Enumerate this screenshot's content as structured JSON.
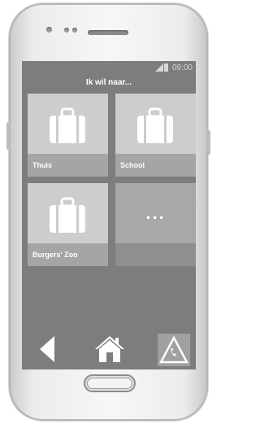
{
  "status_bar": {
    "time": "09:00"
  },
  "header": {
    "title": "Ik wil naar..."
  },
  "tiles": [
    {
      "label": "Thuis",
      "icon": "suitcase-icon"
    },
    {
      "label": "School",
      "icon": "suitcase-icon"
    },
    {
      "label": "Burgers' Zoo",
      "icon": "suitcase-icon"
    }
  ],
  "more_tile": {
    "label": "..."
  },
  "navbar": {
    "back_icon": "back-arrow-icon",
    "home_icon": "home-icon",
    "call_icon": "call-icon"
  },
  "colors": {
    "screen_bg": "#7d7d7d",
    "tile_bg": "#cdcdcd",
    "tile_label_bg": "#a5a5a5"
  }
}
